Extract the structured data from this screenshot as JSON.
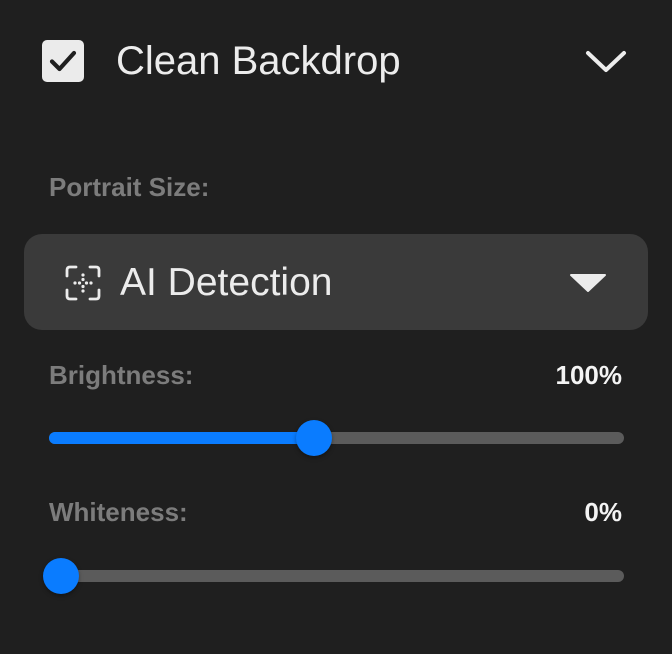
{
  "header": {
    "checked": true,
    "title": "Clean Backdrop"
  },
  "portrait_size": {
    "label": "Portrait Size:",
    "selected": "AI Detection",
    "icon": "ai-detection-icon"
  },
  "sliders": {
    "brightness": {
      "label": "Brightness:",
      "value_text": "100%",
      "level": 0.46
    },
    "whiteness": {
      "label": "Whiteness:",
      "value_text": "0%",
      "level": 0.02
    }
  },
  "colors": {
    "background": "#1f1f1f",
    "accent": "#0a7cff",
    "select_background": "#3a3a3a",
    "muted_label": "#7c7c7c",
    "track": "#5b5b5b"
  }
}
